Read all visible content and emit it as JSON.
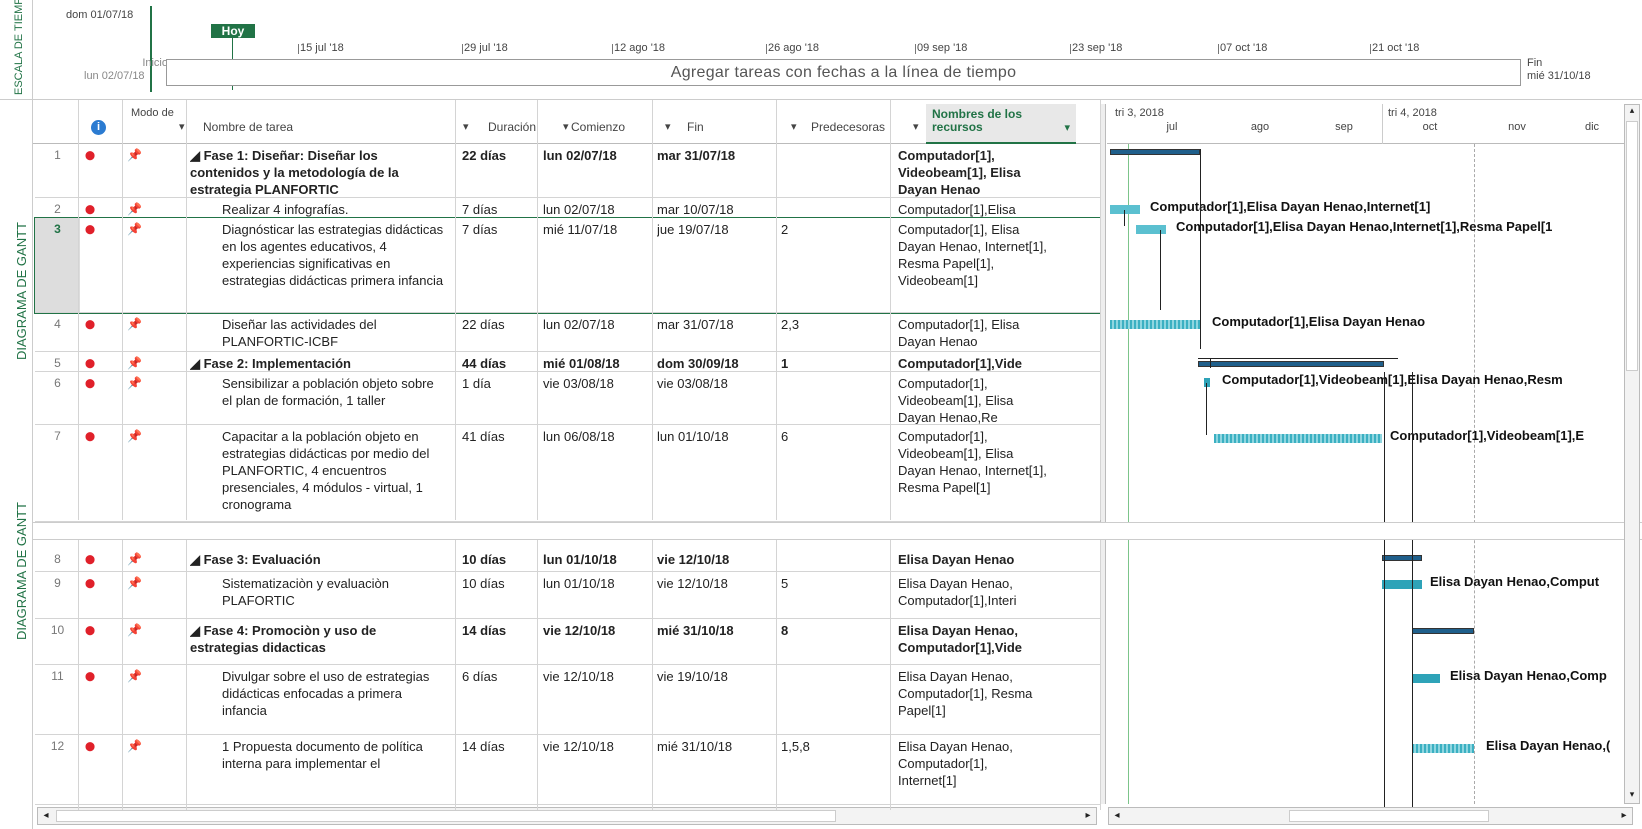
{
  "timeline": {
    "side_label": "ESCALA DE TIEMPO",
    "start_date_top": "dom 01/07/18",
    "today_label": "Hoy",
    "ticks": [
      "15 jul '18",
      "29 jul '18",
      "12 ago '18",
      "26 ago '18",
      "09 sep '18",
      "23 sep '18",
      "07 oct '18",
      "21 oct '18"
    ],
    "start_label": "Inicio",
    "start_date": "lun 02/07/18",
    "placeholder": "Agregar tareas con fechas a la línea de tiempo",
    "end_label": "Fin",
    "end_date": "mié 31/10/18"
  },
  "view_tab": "DIAGRAMA DE GANTT",
  "view_tab_2": "DIAGRAMA DE GANTT",
  "columns": {
    "mode": "Modo de",
    "name": "Nombre de tarea",
    "duration": "Duración",
    "start": "Comienzo",
    "end": "Fin",
    "pred": "Predecesoras",
    "resources": "Nombres de los recursos"
  },
  "gantt_header": {
    "q3": "tri 3, 2018",
    "q4": "tri 4, 2018",
    "months": [
      "jul",
      "ago",
      "sep",
      "oct",
      "nov",
      "dic"
    ]
  },
  "tasks": [
    {
      "id": "1",
      "name": "◢ Fase 1: Diseñar: Diseñar los contenidos y la metodología de la estrategia PLANFORTIC",
      "duration": "22 días",
      "start": "lun 02/07/18",
      "end": "mar 31/07/18",
      "pred": "",
      "res": "Computador[1], Videobeam[1], Elisa Dayan Henao",
      "gantt_label": ""
    },
    {
      "id": "2",
      "name": "Realizar 4 infografías.",
      "duration": "7 días",
      "start": "lun 02/07/18",
      "end": "mar 10/07/18",
      "pred": "",
      "res": "Computador[1],Elisa",
      "gantt_label": "Computador[1],Elisa Dayan Henao,Internet[1]"
    },
    {
      "id": "3",
      "name": "Diagnósticar las estrategias didácticas en los agentes educativos, 4 experiencias significativas en estrategias didácticas primera infancia",
      "duration": "7 días",
      "start": "mié 11/07/18",
      "end": "jue 19/07/18",
      "pred": "2",
      "res": "Computador[1], Elisa Dayan Henao, Internet[1], Resma Papel[1], Videobeam[1]",
      "gantt_label": "Computador[1],Elisa Dayan Henao,Internet[1],Resma Papel[1"
    },
    {
      "id": "4",
      "name": "Diseñar las actividades del PLANFORTIC-ICBF",
      "duration": "22 días",
      "start": "lun 02/07/18",
      "end": "mar 31/07/18",
      "pred": "2,3",
      "res": "Computador[1], Elisa Dayan Henao",
      "gantt_label": "Computador[1],Elisa Dayan Henao"
    },
    {
      "id": "5",
      "name": "◢ Fase 2: Implementación",
      "duration": "44 días",
      "start": "mié 01/08/18",
      "end": "dom 30/09/18",
      "pred": "1",
      "res": "Computador[1],Vide",
      "gantt_label": ""
    },
    {
      "id": "6",
      "name": "Sensibilizar a población objeto sobre el plan de formación, 1 taller",
      "duration": "1 día",
      "start": "vie 03/08/18",
      "end": "vie 03/08/18",
      "pred": "",
      "res": "Computador[1], Videobeam[1], Elisa Dayan Henao,Re",
      "gantt_label": "Computador[1],Videobeam[1],Elisa Dayan Henao,Resm"
    },
    {
      "id": "7",
      "name": "Capacitar a la población objeto en estrategias didácticas por medio del PLANFORTIC, 4 encuentros presenciales, 4 módulos - virtual, 1 cronograma",
      "duration": "41 días",
      "start": "lun 06/08/18",
      "end": "lun 01/10/18",
      "pred": "6",
      "res": "Computador[1], Videobeam[1], Elisa Dayan Henao, Internet[1], Resma Papel[1]",
      "gantt_label": "Computador[1],Videobeam[1],E"
    },
    {
      "id": "8",
      "name": "◢ Fase 3: Evaluación",
      "duration": "10 días",
      "start": "lun 01/10/18",
      "end": "vie 12/10/18",
      "pred": "",
      "res": "Elisa Dayan Henao",
      "gantt_label": ""
    },
    {
      "id": "9",
      "name": "Sistematizaciòn y evaluaciòn PLAFORTIC",
      "duration": "10 días",
      "start": "lun 01/10/18",
      "end": "vie 12/10/18",
      "pred": "5",
      "res": "Elisa Dayan Henao, Computador[1],Interi",
      "gantt_label": "Elisa Dayan Henao,Comput"
    },
    {
      "id": "10",
      "name": "◢ Fase 4: Promociòn y uso de estrategias didacticas",
      "duration": "14 días",
      "start": "vie 12/10/18",
      "end": "mié 31/10/18",
      "pred": "8",
      "res": "Elisa Dayan Henao, Computador[1],Vide",
      "gantt_label": ""
    },
    {
      "id": "11",
      "name": "Divulgar sobre el uso de estrategias didácticas enfocadas a primera infancia",
      "duration": "6 días",
      "start": "vie 12/10/18",
      "end": "vie 19/10/18",
      "pred": "",
      "res": "Elisa Dayan Henao, Computador[1], Resma Papel[1]",
      "gantt_label": "Elisa Dayan Henao,Comp"
    },
    {
      "id": "12",
      "name": "1 Propuesta documento de política interna para implementar el",
      "duration": "14 días",
      "start": "vie 12/10/18",
      "end": "mié 31/10/18",
      "pred": "1,5,8",
      "res": "Elisa Dayan Henao, Computador[1], Internet[1]",
      "gantt_label": "Elisa Dayan Henao,("
    }
  ]
}
